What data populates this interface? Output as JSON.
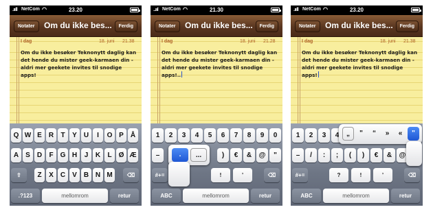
{
  "phones": [
    {
      "status": {
        "signal": ".ııll",
        "carrier": "NetCom",
        "wifi": "◠",
        "time": "23.20"
      },
      "nav": {
        "back": "Notater",
        "title": "Om du ikke bes...",
        "done": "Ferdig"
      },
      "note": {
        "day": "I dag",
        "date": "18. juni",
        "clock": "21.38",
        "text": "Om du ikke besøker Teknonytt daglig kan det hende du mister geek-karmaen din - aldri mer geekete invites til snodige apps!"
      }
    },
    {
      "status": {
        "signal": "..ııl",
        "carrier": "NetCom",
        "wifi": "◠",
        "time": "21.30"
      },
      "nav": {
        "back": "Notater",
        "title": "Om du ikke bes...",
        "done": "Ferdig"
      },
      "note": {
        "day": "I dag",
        "date": "18. juni",
        "clock": "21.28",
        "text": "Om du ikke besøker Teknonytt daglig kan det hende du mister geek-karmaen din - aldri mer geekete invites til snodige apps!.."
      }
    },
    {
      "status": {
        "signal": ".ııll",
        "carrier": "NetCom",
        "wifi": "◠",
        "time": "23.20"
      },
      "nav": {
        "back": "Notater",
        "title": "Om du ikke bes...",
        "done": "Ferdig"
      },
      "note": {
        "day": "I dag",
        "date": "18. juni",
        "clock": "21.38",
        "text": "Om du ikke besøker Teknonytt daglig kan det hende du mister geek-karmaen din - aldri mer geekete invites til snodige apps!"
      }
    }
  ],
  "keyboard1": {
    "row1": [
      "Q",
      "W",
      "E",
      "R",
      "T",
      "Y",
      "U",
      "I",
      "O",
      "P",
      "Å"
    ],
    "row2": [
      "A",
      "S",
      "D",
      "F",
      "G",
      "H",
      "J",
      "K",
      "L",
      "Ø",
      "Æ"
    ],
    "row3": [
      "Z",
      "X",
      "C",
      "V",
      "B",
      "N",
      "M"
    ],
    "shift": "⇧",
    "backspace": "⌫",
    "mode": ".?123",
    "space": "mellomrom",
    "return": "retur"
  },
  "keyboard2": {
    "row1": [
      "1",
      "2",
      "3",
      "4",
      "5",
      "6",
      "7",
      "8",
      "9",
      "0"
    ],
    "row2_visible": [
      "–",
      ")",
      "€",
      "&",
      "@",
      "\""
    ],
    "row3_visible": [
      "!",
      "’"
    ],
    "popup": [
      ".",
      "..."
    ],
    "mode_sym": "#+=",
    "backspace": "⌫",
    "mode": "ABC",
    "space": "mellomrom",
    "return": "retur"
  },
  "keyboard3": {
    "row1_visible": [
      "1",
      "2",
      "3",
      "4"
    ],
    "row2": [
      "–",
      "/",
      ":",
      ";",
      "(",
      ")",
      "€",
      "&",
      "@"
    ],
    "row3_visible": [
      "?",
      "!",
      "’"
    ],
    "popup": [
      "„",
      "\"",
      "“",
      "»",
      "«",
      "\""
    ],
    "mode_sym": "#+=",
    "backspace": "⌫",
    "mode": "ABC",
    "space": "mellomrom",
    "return": "retur"
  }
}
